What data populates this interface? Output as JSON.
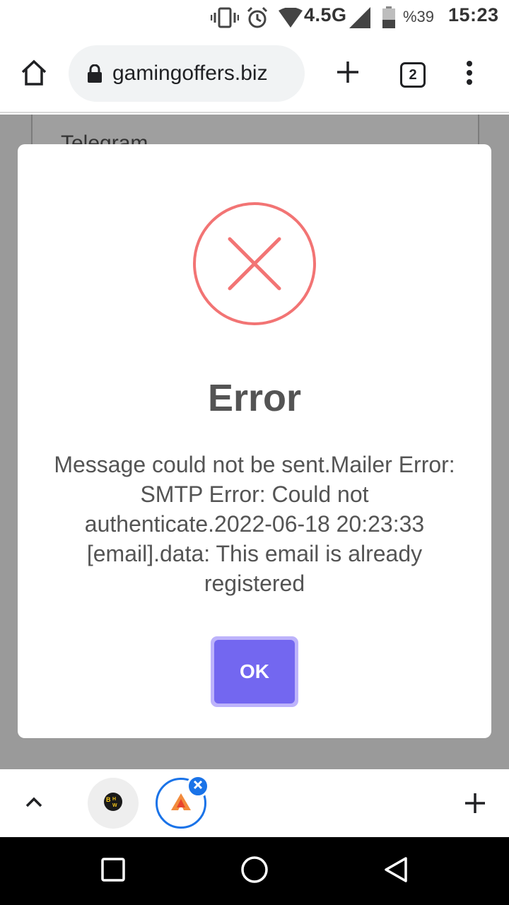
{
  "status_bar": {
    "network": "4.5G",
    "battery": "%39",
    "time": "15:23",
    "icons": [
      "vibrate-icon",
      "alarm-icon",
      "wifi-icon",
      "signal-icon",
      "battery-icon"
    ]
  },
  "browser": {
    "url": "gamingoffers.biz",
    "tab_count": "2",
    "icons": [
      "home-icon",
      "lock-icon",
      "new-tab-icon",
      "menu-icon"
    ]
  },
  "background_page": {
    "panel_text": "Telegram"
  },
  "dialog": {
    "title": "Error",
    "message": "Message could not be sent.Mailer Error: SMTP Error: Could not authenticate.2022-06-18 20:23:33 [email].data: This email is already registered",
    "ok_label": "OK",
    "colors": {
      "error": "#f27474",
      "ok_button": "#7367f0",
      "text": "#545454"
    }
  },
  "tab_strip": {
    "tabs": [
      {
        "name": "tab-bhw",
        "favicon_text": "BHW"
      },
      {
        "name": "tab-gamingoffers",
        "active": true
      }
    ]
  },
  "nav_bar": {
    "icons": [
      "recents-icon",
      "home-icon",
      "back-icon"
    ]
  }
}
